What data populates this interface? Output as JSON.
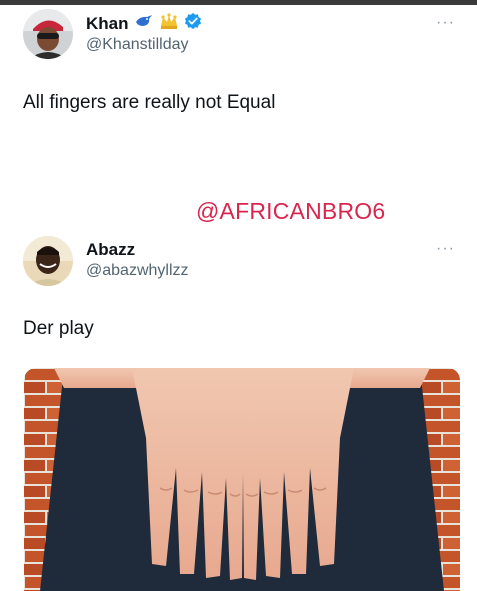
{
  "tweet": {
    "display_name": "Khan",
    "handle": "@Khanstillday",
    "text": "All fingers are really not Equal",
    "more_label": "···",
    "icons": [
      "bird-emoji-icon",
      "crown-emoji-icon",
      "verified-badge-icon"
    ]
  },
  "watermark": "@AFRICANBRO6",
  "reply": {
    "display_name": "Abazz",
    "handle": "@abazwhyllzz",
    "text": "Der play",
    "more_label": "···"
  },
  "colors": {
    "verified": "#1d9bf0",
    "watermark": "#d8264e",
    "secondary_text": "#536471"
  }
}
